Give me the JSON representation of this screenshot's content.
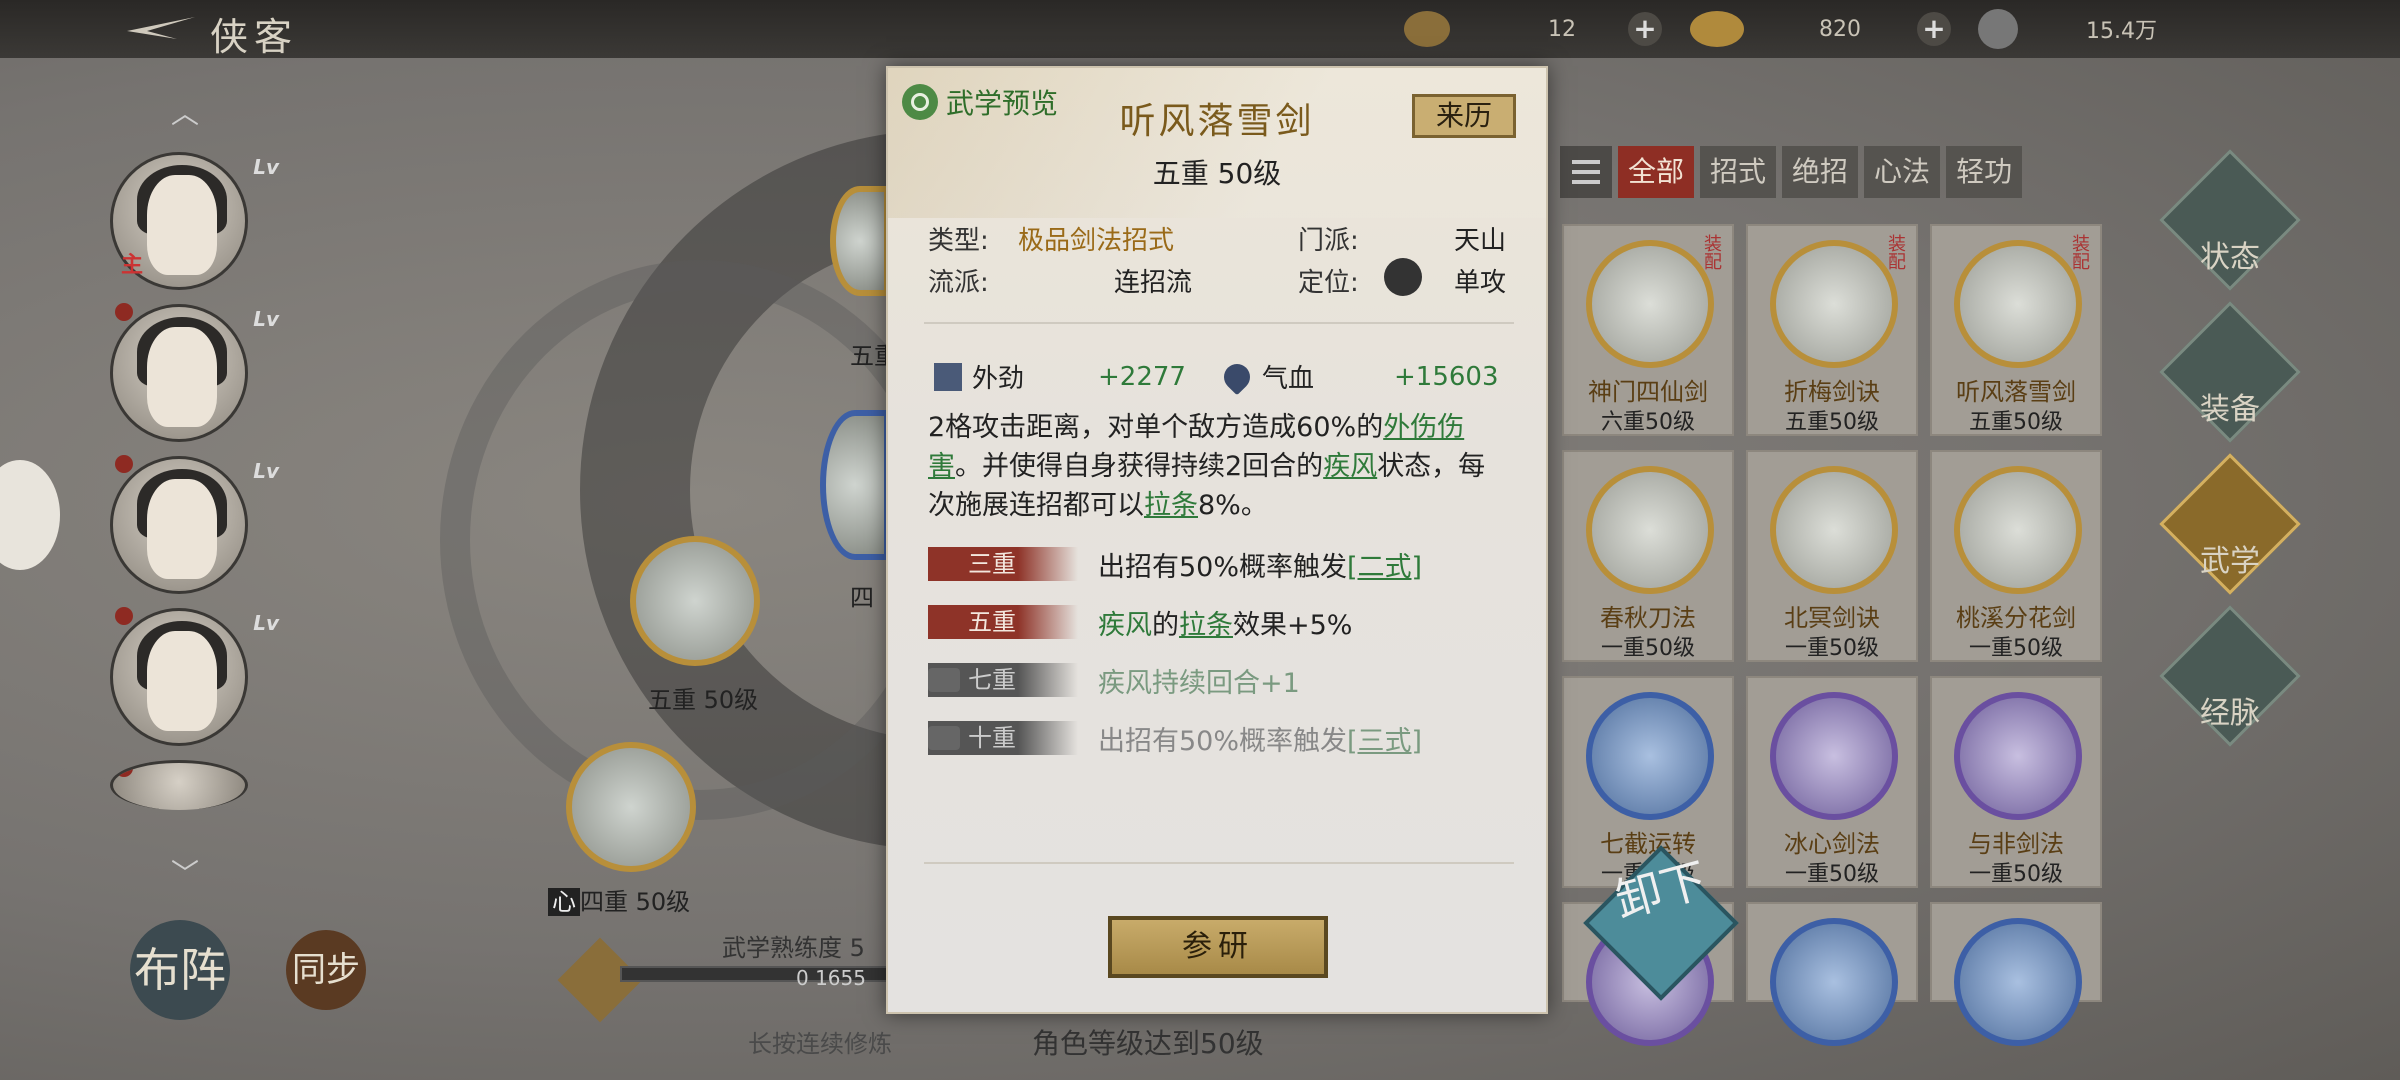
{
  "topbar": {
    "title": "侠客",
    "res1": "12",
    "res2": "820",
    "res3": "15.4万"
  },
  "left": {
    "node_lv1": "五重",
    "node_lv2": "四",
    "node_lv3": "五重 50级",
    "node_lv4": "四重 50级",
    "heart": "心",
    "btn1": "布阵",
    "btn2": "同步",
    "proficiency": "武学熟练度 5",
    "prof_val": "0 1655",
    "hint1": "长按连续修炼",
    "hint2": "角色等级达到50级",
    "avatar_lv": "Lv",
    "avatar_main": "主"
  },
  "dialog": {
    "preview": "武学预览",
    "name": "听风落雪剑",
    "origin": "来历",
    "rank": "五重 50级",
    "type_k": "类型:",
    "type_v": "极品剑法招式",
    "sect_k": "门派:",
    "sect_v": "天山",
    "school_k": "流派:",
    "school_v": "连招流",
    "pos_k": "定位:",
    "pos_v": "单攻",
    "stat1_k": "外劲",
    "stat1_v": "+2277",
    "stat2_k": "气血",
    "stat2_v": "+15603",
    "desc1": "2格攻击距离，对单个敌方造成60%的",
    "desc1u": "外伤伤害",
    "desc2": "。并使得自身获得持续2回合的",
    "desc2g": "疾风",
    "desc3": "状态，每次施展连招都可以",
    "desc3u": "拉条",
    "desc4": "8%。",
    "tiers": [
      {
        "label": "三重",
        "pre": "出招有50%概率触发",
        "link": "[二式]",
        "post": ""
      },
      {
        "label": "五重",
        "pre": "疾风",
        "mid": "的",
        "link": "拉条",
        "post": "效果+5%"
      },
      {
        "label": "七重",
        "pre": "疾风持续回合+1",
        "link": "",
        "post": ""
      },
      {
        "label": "十重",
        "pre": "出招有50%概率触发",
        "link": "[三式]",
        "post": ""
      }
    ],
    "research": "参研"
  },
  "tabs": [
    "全部",
    "招式",
    "绝招",
    "心法",
    "轻功"
  ],
  "cards": [
    {
      "name": "神门四仙剑",
      "lv": "六重50级",
      "equip": "装配"
    },
    {
      "name": "折梅剑诀",
      "lv": "五重50级",
      "equip": "装配"
    },
    {
      "name": "听风落雪剑",
      "lv": "五重50级",
      "equip": "装配"
    },
    {
      "name": "春秋刀法",
      "lv": "一重50级"
    },
    {
      "name": "北冥剑诀",
      "lv": "一重50级"
    },
    {
      "name": "桃溪分花剑",
      "lv": "一重50级"
    },
    {
      "name": "七截运转",
      "lv": "一重50级"
    },
    {
      "name": "冰心剑法",
      "lv": "一重50级"
    },
    {
      "name": "与非剑法",
      "lv": "一重50级"
    }
  ],
  "sidenav": [
    "状态",
    "装备",
    "武学",
    "经脉"
  ],
  "unload": "卸下"
}
